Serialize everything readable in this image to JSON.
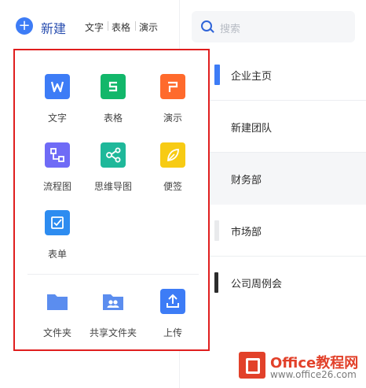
{
  "left": {
    "new_label": "新建",
    "quick": [
      "文字",
      "表格",
      "演示"
    ]
  },
  "search": {
    "placeholder": "搜索"
  },
  "list": [
    {
      "label": "企业主页",
      "accent": "#3d7cf6"
    },
    {
      "label": "新建团队",
      "accent": ""
    },
    {
      "label": "财务部",
      "accent": ""
    },
    {
      "label": "市场部",
      "accent": ""
    },
    {
      "label": "公司周例会",
      "accent": ""
    }
  ],
  "popup": {
    "create": [
      {
        "label": "文字",
        "color": "#3d7cf6",
        "icon": "doc-w-icon"
      },
      {
        "label": "表格",
        "color": "#12b76a",
        "icon": "sheet-s-icon"
      },
      {
        "label": "演示",
        "color": "#ff6a2c",
        "icon": "slides-p-icon"
      },
      {
        "label": "流程图",
        "color": "#6f6bf6",
        "icon": "flowchart-icon"
      },
      {
        "label": "思维导图",
        "color": "#1fb89a",
        "icon": "mindmap-icon"
      },
      {
        "label": "便签",
        "color": "#f7cb14",
        "icon": "leaf-note-icon"
      },
      {
        "label": "表单",
        "color": "#2d8cf0",
        "icon": "form-icon"
      }
    ],
    "folders": [
      {
        "label": "文件夹",
        "color": "#5b8def",
        "icon": "folder-icon"
      },
      {
        "label": "共享文件夹",
        "color": "#5b8def",
        "icon": "shared-folder-icon"
      },
      {
        "label": "上传",
        "color": "#3d7cf6",
        "icon": "upload-icon"
      }
    ]
  },
  "watermark": {
    "title": "Office教程网",
    "url": "www.office26.com"
  }
}
